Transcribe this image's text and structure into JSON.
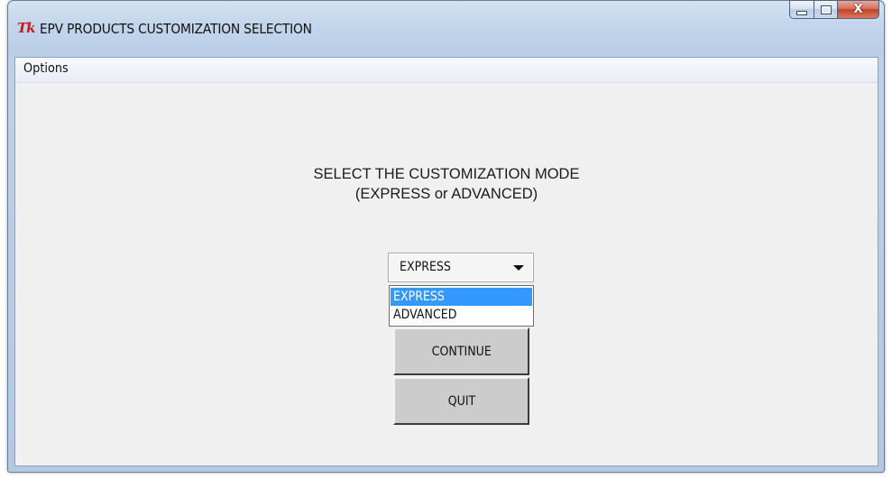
{
  "window": {
    "title": "EPV PRODUCTS CUSTOMIZATION SELECTION",
    "app_icon": "Tk",
    "controls": {
      "minimize_icon": "minimize-icon",
      "maximize_icon": "maximize-icon",
      "close_icon": "close-icon",
      "close_glyph": "X"
    }
  },
  "menubar": {
    "items": [
      {
        "label": "Options"
      }
    ]
  },
  "main": {
    "heading_line1": "SELECT THE CUSTOMIZATION MODE",
    "heading_line2": "(EXPRESS or ADVANCED)",
    "combo": {
      "selected_value": "EXPRESS",
      "arrow_icon": "chevron-down-icon",
      "options": [
        {
          "label": "EXPRESS",
          "highlighted": true
        },
        {
          "label": "ADVANCED",
          "highlighted": false
        }
      ]
    },
    "buttons": {
      "continue_label": "CONTINUE",
      "quit_label": "QUIT"
    }
  },
  "colors": {
    "selection_highlight": "#3399ff",
    "client_background": "#f0f0f0",
    "button_face": "#cccccc",
    "app_icon_red": "#c31b1b"
  }
}
